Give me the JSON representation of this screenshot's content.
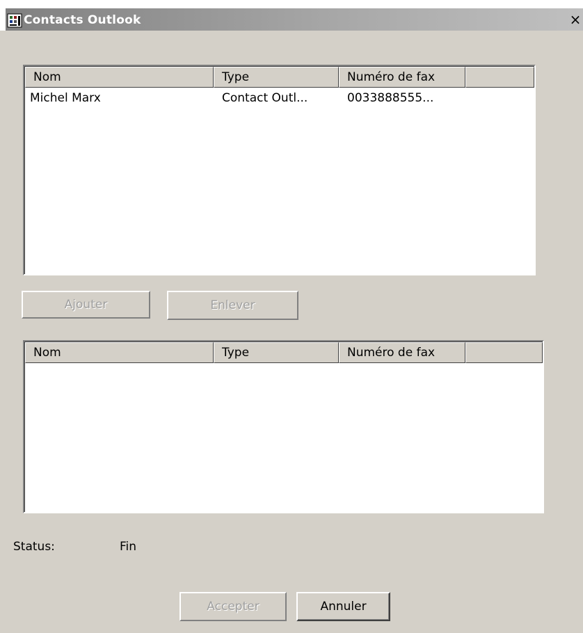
{
  "window": {
    "title": "Contacts Outlook",
    "close_symbol": "×",
    "app_icon": "contacts-app-icon",
    "title_bar_color": "#808080",
    "face_color": "#d4d0c8"
  },
  "source_list": {
    "columns": [
      "Nom",
      "Type",
      "Numéro de fax"
    ],
    "rows": [
      {
        "nom": "Michel Marx",
        "type": "Contact Outl...",
        "fax": "0033888555..."
      }
    ]
  },
  "buttons": {
    "ajouter": "Ajouter",
    "enlever": "Enlever",
    "accepter": "Accepter",
    "annuler": "Annuler"
  },
  "selected_list": {
    "columns": [
      "Nom",
      "Type",
      "Numéro de fax"
    ],
    "rows": []
  },
  "status": {
    "label": "Status:",
    "value": "Fin"
  }
}
